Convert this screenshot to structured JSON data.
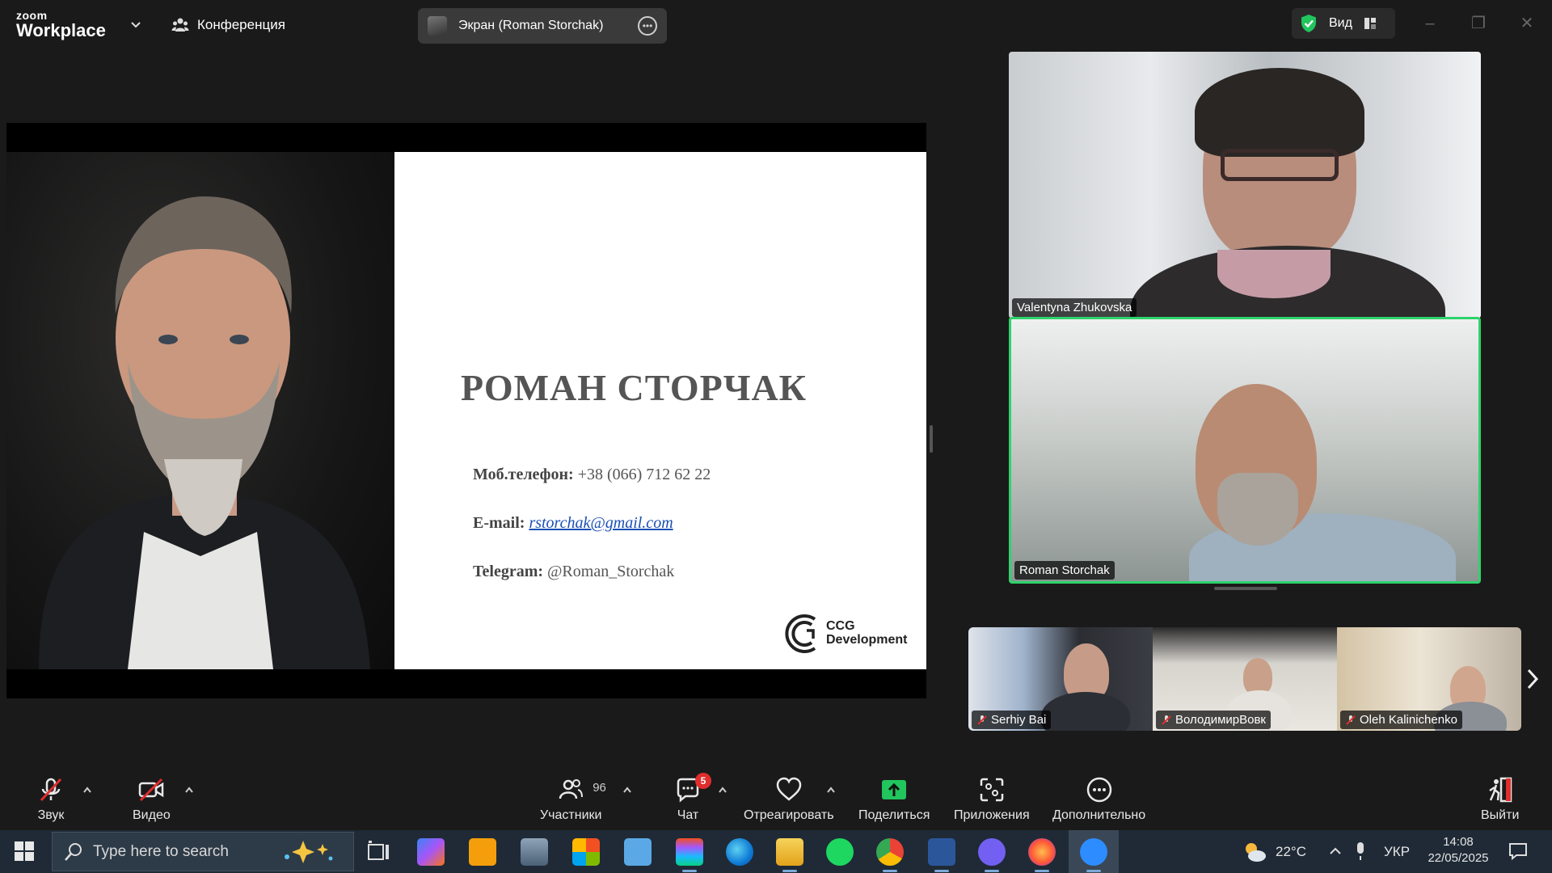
{
  "brand": {
    "line1": "zoom",
    "line2": "Workplace"
  },
  "topbar": {
    "conference_label": "Конференция",
    "screen_share_label": "Экран (Roman Storchak)",
    "view_label": "Вид"
  },
  "slide": {
    "name": "РОМАН СТОРЧАК",
    "phone_label": "Моб.телефон:",
    "phone_value": "+38 (066) 712 62 22",
    "email_label": "E-mail:",
    "email_value": "rstorchak@gmail.com",
    "telegram_label": "Telegram:",
    "telegram_value": "@Roman_Storchak",
    "logo_line1": "CCG",
    "logo_line2": "Development"
  },
  "participants_video": [
    {
      "name": "Valentyna Zhukovska",
      "muted": false,
      "active_speaker": false
    },
    {
      "name": "Roman Storchak",
      "muted": false,
      "active_speaker": true
    },
    {
      "name": "Serhiy Bai",
      "muted": true
    },
    {
      "name": "ВолодимирВовк",
      "muted": true
    },
    {
      "name": "Oleh Kalinichenko",
      "muted": true
    }
  ],
  "toolbar": {
    "audio_label": "Звук",
    "video_label": "Видео",
    "participants_label": "Участники",
    "participants_count": "96",
    "chat_label": "Чат",
    "chat_badge": "5",
    "react_label": "Отреагировать",
    "share_label": "Поделиться",
    "apps_label": "Приложения",
    "more_label": "Дополнительно",
    "leave_label": "Выйти"
  },
  "taskbar": {
    "search_placeholder": "Type here to search",
    "weather": "22°C",
    "language": "УКР",
    "time": "14:08",
    "date": "22/05/2025"
  },
  "colors": {
    "active_speaker_border": "#2ed36b",
    "share_button_green": "#21c45d",
    "muted_red": "#e02d2d",
    "taskbar_bg": "#1f2a36"
  }
}
